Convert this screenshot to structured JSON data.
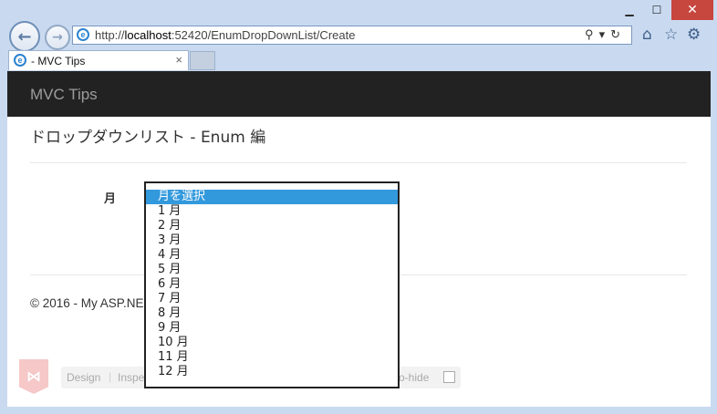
{
  "browser": {
    "url_prefix": "http://",
    "url_host": "localhost",
    "url_path": ":52420/EnumDropDownList/Create",
    "tab_title": "- MVC Tips",
    "tab_close": "×",
    "addr_tools": "⚲▾↻",
    "window_min": "▁",
    "window_max": "☐",
    "window_close": "✕"
  },
  "page": {
    "brand": "MVC Tips",
    "heading": "ドロップダウンリスト - Enum 編",
    "field_label": "月",
    "footer_text": "© 2016 - My ASP.NE"
  },
  "dropdown": {
    "selected_label": "月を選択",
    "options": [
      "月を選択",
      "1 月",
      "2 月",
      "3 月",
      "4 月",
      "5 月",
      "6 月",
      "7 月",
      "8 月",
      "9 月",
      "10 月",
      "11 月",
      "12 月"
    ]
  },
  "browser_link": {
    "design": "Design",
    "separator": "|",
    "inspect": "Inspe",
    "autohide": "uto-hide"
  }
}
